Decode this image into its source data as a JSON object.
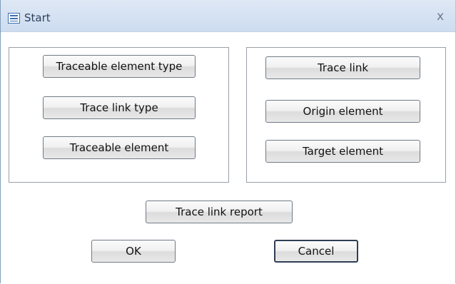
{
  "window": {
    "title": "Start",
    "close_glyph": "x",
    "icon": "form-icon"
  },
  "left_group": {
    "buttons": [
      {
        "label": "Traceable element type"
      },
      {
        "label": "Trace link type"
      },
      {
        "label": "Traceable element"
      }
    ]
  },
  "right_group": {
    "buttons": [
      {
        "label": "Trace link"
      },
      {
        "label": "Origin element"
      },
      {
        "label": "Target element"
      }
    ]
  },
  "report_button": {
    "label": "Trace link report"
  },
  "ok_button": {
    "label": "OK"
  },
  "cancel_button": {
    "label": "Cancel"
  }
}
